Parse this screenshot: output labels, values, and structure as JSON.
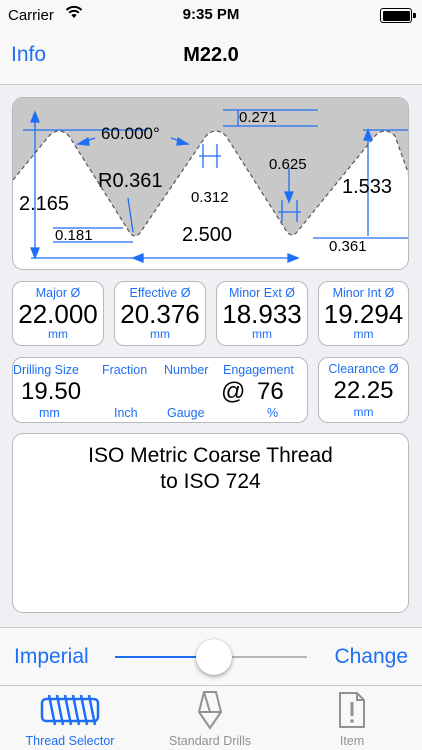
{
  "status": {
    "carrier": "Carrier",
    "time": "9:35 PM"
  },
  "nav": {
    "left_button": "Info",
    "title": "M22.0"
  },
  "diagram": {
    "angle": "60.000°",
    "pitch_top": "0.271",
    "height_left": "2.165",
    "radius": "R0.361",
    "flat_crest": "0.312",
    "flat_root": "0.625",
    "depth_right": "1.533",
    "bottom_left": "0.181",
    "pitch": "2.500",
    "bottom_right": "0.361"
  },
  "measurements": [
    {
      "label": "Major Ø",
      "value": "22.000",
      "unit": "mm"
    },
    {
      "label": "Effective Ø",
      "value": "20.376",
      "unit": "mm"
    },
    {
      "label": "Minor Ext Ø",
      "value": "18.933",
      "unit": "mm"
    },
    {
      "label": "Minor Int Ø",
      "value": "19.294",
      "unit": "mm"
    }
  ],
  "drilling": {
    "size_label": "Drilling Size",
    "size_value": "19.50",
    "size_unit": "mm",
    "fraction_label": "Fraction",
    "fraction_unit": "Inch",
    "number_label": "Number",
    "number_unit": "Gauge",
    "engagement_label": "Engagement",
    "engagement_at": "@",
    "engagement_value": "76",
    "engagement_unit": "%"
  },
  "clearance": {
    "label": "Clearance Ø",
    "value": "22.25",
    "unit": "mm"
  },
  "description": {
    "line1": "ISO Metric Coarse Thread",
    "line2": "to ISO 724"
  },
  "controls": {
    "left_label": "Imperial",
    "right_label": "Change",
    "slider_level": 0.5
  },
  "tabs": [
    {
      "label": "Thread Selector",
      "icon": "thread-icon",
      "active": true
    },
    {
      "label": "Standard Drills",
      "icon": "drill-icon",
      "active": false
    },
    {
      "label": "Item",
      "icon": "item-document-icon",
      "active": false
    }
  ],
  "colors": {
    "accent": "#1e6ff5",
    "diagram_fill": "#c8c8c8"
  }
}
